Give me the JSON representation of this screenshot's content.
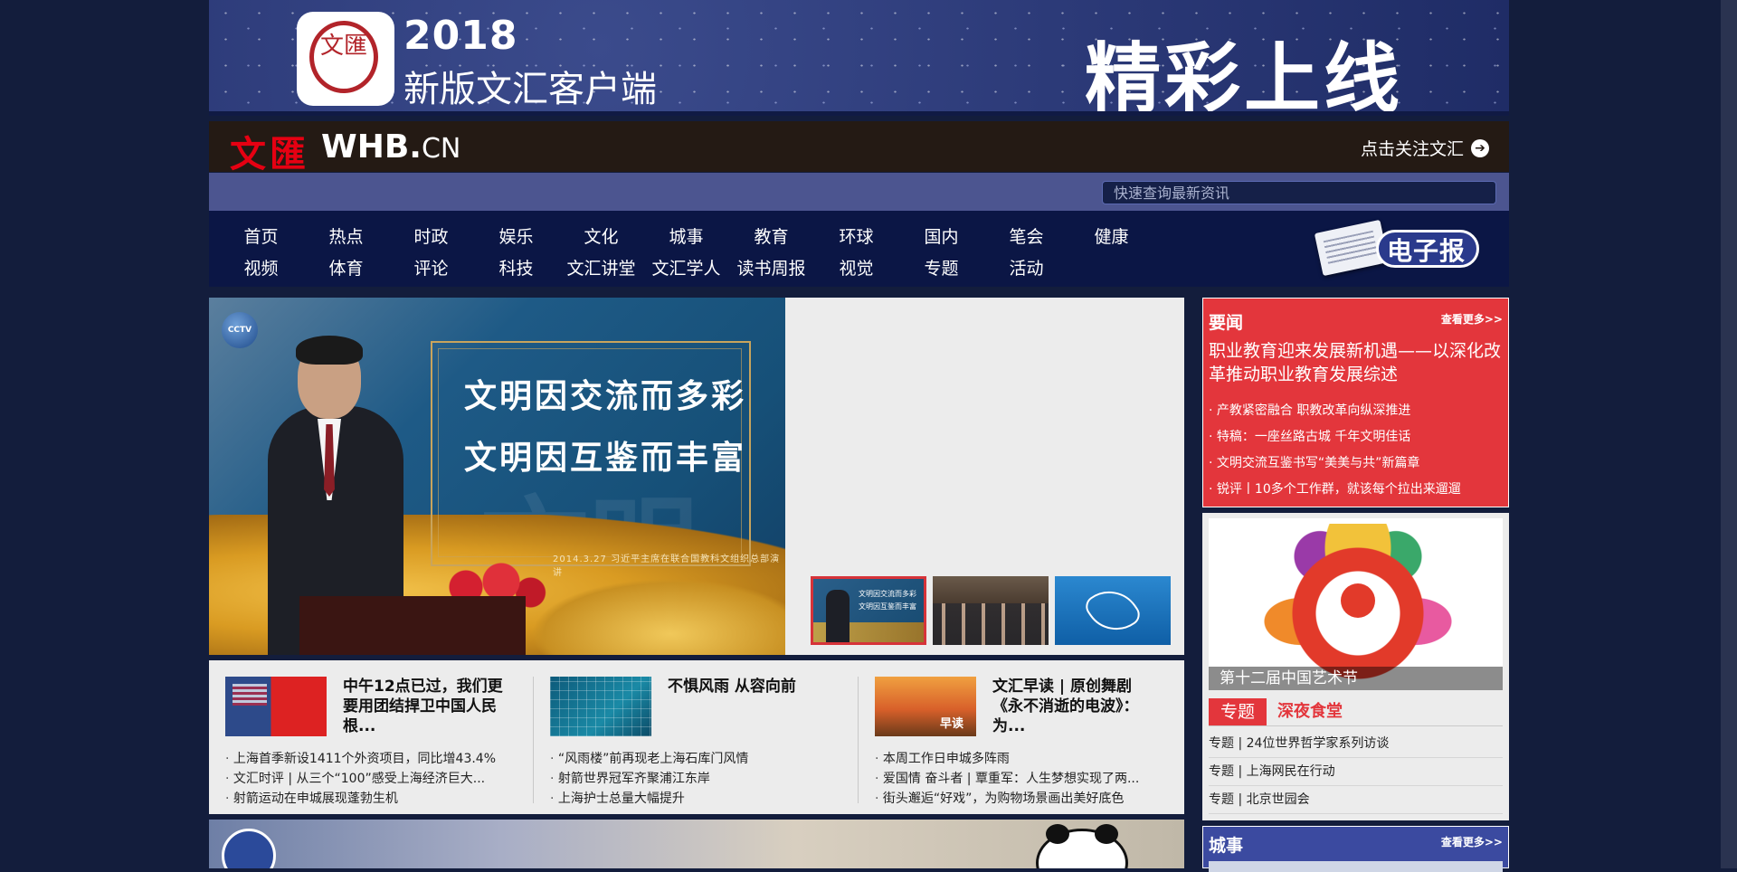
{
  "banner": {
    "app_icon_text": "文匯",
    "year": "2018",
    "subtitle": "新版文汇客户端",
    "promo": "精彩上线"
  },
  "header": {
    "logo_cn": "文匯",
    "logo_en": "WHB.",
    "logo_en_suffix": "CN",
    "follow_label": "点击关注文汇"
  },
  "search": {
    "placeholder": "快速查询最新资讯"
  },
  "nav": {
    "row1": [
      "首页",
      "热点",
      "时政",
      "娱乐",
      "文化",
      "城事",
      "教育",
      "环球",
      "国内",
      "笔会",
      "健康"
    ],
    "row2": [
      "视频",
      "体育",
      "评论",
      "科技",
      "文汇讲堂",
      "文汇学人",
      "读书周报",
      "视觉",
      "专题",
      "活动"
    ],
    "epaper_label": "电子报"
  },
  "hero": {
    "line1": "文明因交流而多彩",
    "line2": "文明因互鉴而丰富",
    "date": "2014.3.27  习近平主席在联合国教科文组织总部演讲",
    "badge": "CCTV 央视新闻"
  },
  "headlines": [
    {
      "title": "中午12点已过，我们更要用团结捍卫中国人民根...",
      "items": [
        "上海首季新设1411个外资项目，同比增43.4%",
        "文汇时评 | 从三个“100”感受上海经济巨大...",
        "射箭运动在申城展现蓬勃生机"
      ]
    },
    {
      "title": "不惧风雨 从容向前",
      "items": [
        "“风雨楼”前再现老上海石库门风情",
        "射箭世界冠军齐聚浦江东岸",
        "上海护士总量大幅提升"
      ]
    },
    {
      "title": "文汇早读 | 原创舞剧《永不消逝的电波》：为...",
      "items": [
        "本周工作日申城多阵雨",
        "爱国情 奋斗者 | 覃重军：人生梦想实现了两...",
        "街头邂逅“好戏”，为购物场景画出美好底色"
      ]
    }
  ],
  "news": {
    "heading": "要闻",
    "more": "查看更多>>",
    "lead": "职业教育迎来发展新机遇——以深化改革推动职业教育发展综述",
    "items": [
      "产教紧密融合 职教改革向纵深推进",
      "特稿：一座丝路古城  千年文明佳话",
      "文明交流互鉴书写“美美与共”新篇章",
      "锐评丨10多个工作群，就该每个拉出来遛遛"
    ]
  },
  "festival": {
    "caption": "第十二届中国艺术节",
    "tab_active": "专题",
    "tab_other": "深夜食堂",
    "items": [
      "专题 | 24位世界哲学家系列访谈",
      "专题 | 上海网民在行动",
      "专题 | 北京世园会"
    ]
  },
  "city": {
    "heading": "城事",
    "more": "查看更多>>"
  },
  "colors": {
    "accent_red": "#e3363c",
    "nav_bg": "#0b1645",
    "page_bg": "#131d3c"
  }
}
